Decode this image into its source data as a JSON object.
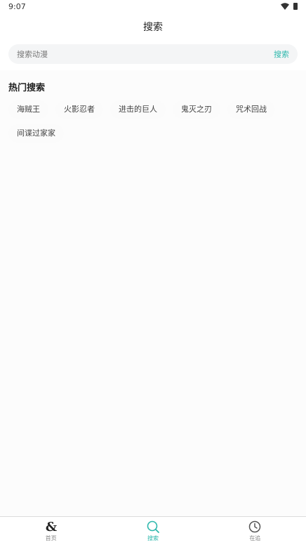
{
  "status_bar": {
    "time": "9:07"
  },
  "header": {
    "title": "搜索"
  },
  "search": {
    "placeholder": "搜索动漫",
    "value": "",
    "button_label": "搜索"
  },
  "hot_search": {
    "title": "热门搜索",
    "tags": [
      "海贼王",
      "火影忍者",
      "进击的巨人",
      "鬼灭之刃",
      "咒术回战",
      "间谍过家家"
    ]
  },
  "bottom_nav": {
    "items": [
      {
        "label": "首页",
        "icon": "ampersand-icon"
      },
      {
        "label": "搜索",
        "icon": "search-icon",
        "active": true
      },
      {
        "label": "在追",
        "icon": "clock-icon"
      }
    ]
  },
  "colors": {
    "accent": "#2fb8ad",
    "text": "#222222",
    "muted": "#888888"
  }
}
